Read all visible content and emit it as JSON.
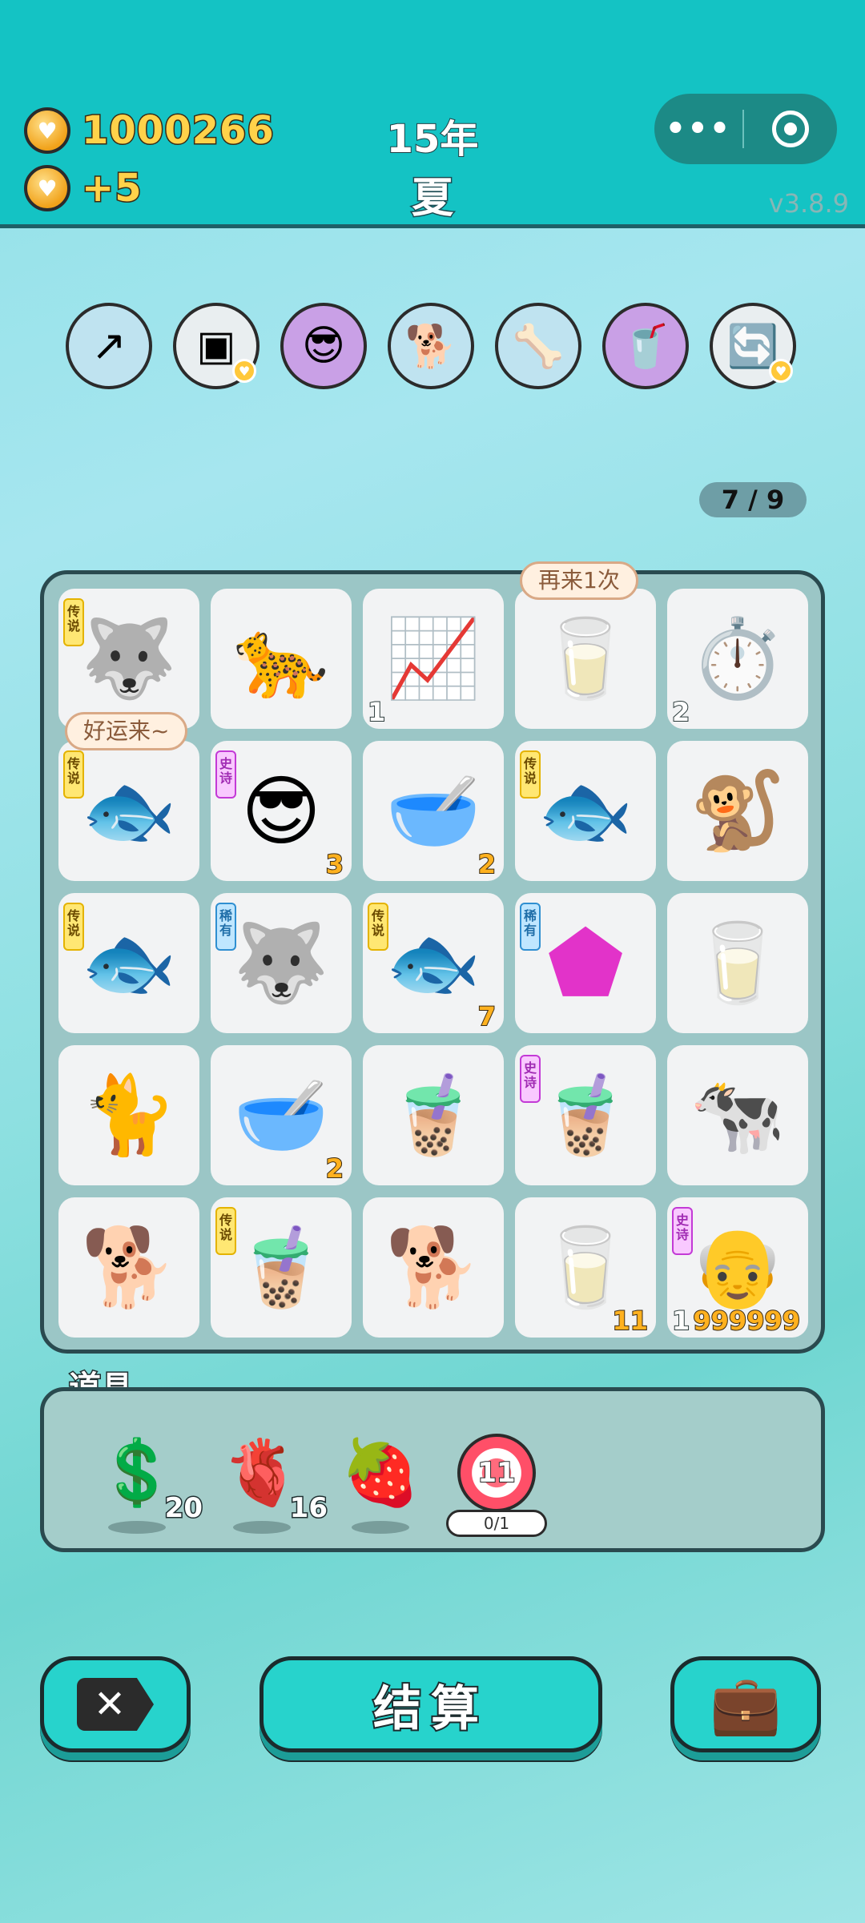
{
  "header": {
    "coins": "1000266",
    "coin_bonus": "+5",
    "year": "15年",
    "season": "夏",
    "version": "v3.8.9",
    "capsule_more": "•••"
  },
  "boosts": [
    {
      "icon": "arrow-up-icon",
      "glyph": "↗"
    },
    {
      "icon": "blocks-icon",
      "glyph": "▣"
    },
    {
      "icon": "multiplier-character-icon",
      "glyph": "😎"
    },
    {
      "icon": "dog-icon",
      "glyph": "🐕"
    },
    {
      "icon": "dog-bowl-icon",
      "glyph": "🦴"
    },
    {
      "icon": "milk-tea-boost-icon",
      "glyph": "🥤"
    },
    {
      "icon": "refresh-icon",
      "glyph": "🔄"
    }
  ],
  "counter": "7 / 9",
  "board": {
    "bubble_again": "再来1次",
    "bubble_luck": "好运来~",
    "tags": {
      "legend": "传说",
      "epic": "史诗",
      "rare": "稀有"
    },
    "cells": [
      {
        "name": "husky-king",
        "glyph": "🐺",
        "tag": "legend",
        "count": "",
        "left": ""
      },
      {
        "name": "cheetah-cat",
        "glyph": "🐆",
        "tag": "",
        "count": "",
        "left": ""
      },
      {
        "name": "trend-card",
        "glyph": "📈",
        "tag": "",
        "count": "",
        "left": "1"
      },
      {
        "name": "milk-bottle-fu",
        "glyph": "🥛",
        "tag": "",
        "count": "",
        "left": ""
      },
      {
        "name": "stopwatch-card",
        "glyph": "⏱️",
        "tag": "",
        "count": "",
        "left": "2"
      },
      {
        "name": "koi-fish",
        "glyph": "🐟",
        "tag": "legend",
        "count": "",
        "left": ""
      },
      {
        "name": "green-hat-man",
        "glyph": "😎",
        "tag": "epic",
        "count": "3",
        "left": ""
      },
      {
        "name": "bowl",
        "glyph": "🥣",
        "tag": "",
        "count": "2",
        "left": ""
      },
      {
        "name": "koi-fish",
        "glyph": "🐟",
        "tag": "legend",
        "count": "",
        "left": ""
      },
      {
        "name": "monkey",
        "glyph": "🐒",
        "tag": "",
        "count": "",
        "left": ""
      },
      {
        "name": "koi-fish",
        "glyph": "🐟",
        "tag": "legend",
        "count": "",
        "left": ""
      },
      {
        "name": "husky",
        "glyph": "🐺",
        "tag": "rare",
        "count": "",
        "left": ""
      },
      {
        "name": "koi-fish",
        "glyph": "🐟",
        "tag": "legend",
        "count": "7",
        "left": ""
      },
      {
        "name": "earth-gem",
        "glyph": "⬟",
        "tag": "rare",
        "count": "",
        "left": ""
      },
      {
        "name": "milk-bottle",
        "glyph": "🥛",
        "tag": "",
        "count": "",
        "left": ""
      },
      {
        "name": "yellow-cat",
        "glyph": "🐈",
        "tag": "",
        "count": "",
        "left": ""
      },
      {
        "name": "bowl",
        "glyph": "🥣",
        "tag": "",
        "count": "2",
        "left": ""
      },
      {
        "name": "small-milk-tea",
        "glyph": "🧋",
        "tag": "",
        "count": "",
        "left": ""
      },
      {
        "name": "tall-milk-tea",
        "glyph": "🧋",
        "tag": "epic",
        "count": "",
        "left": ""
      },
      {
        "name": "cow",
        "glyph": "🐄",
        "tag": "",
        "count": "",
        "left": ""
      },
      {
        "name": "wedding-dog",
        "glyph": "🐕",
        "tag": "",
        "count": "",
        "left": ""
      },
      {
        "name": "big-milk-tea",
        "glyph": "🧋",
        "tag": "legend",
        "count": "",
        "left": ""
      },
      {
        "name": "brown-dog",
        "glyph": "🐕",
        "tag": "",
        "count": "",
        "left": ""
      },
      {
        "name": "milk-bottle-star",
        "glyph": "🥛",
        "tag": "",
        "count": "11",
        "left": ""
      },
      {
        "name": "grandpa",
        "glyph": "👴",
        "tag": "epic",
        "count": "999999",
        "left": "1"
      }
    ]
  },
  "props": {
    "title": "道具",
    "items": [
      {
        "name": "coin-prop",
        "glyph": "💲",
        "count": "20"
      },
      {
        "name": "liver-prop",
        "glyph": "🫀",
        "count": "16"
      },
      {
        "name": "bayberry-prop",
        "glyph": "🍓",
        "count": ""
      },
      {
        "name": "target-prop",
        "glyph": "11",
        "count": ""
      }
    ],
    "target_progress": "0/1"
  },
  "buttons": {
    "settle": "结算",
    "quit_glyph": "✕",
    "bag_glyph": "💼"
  }
}
